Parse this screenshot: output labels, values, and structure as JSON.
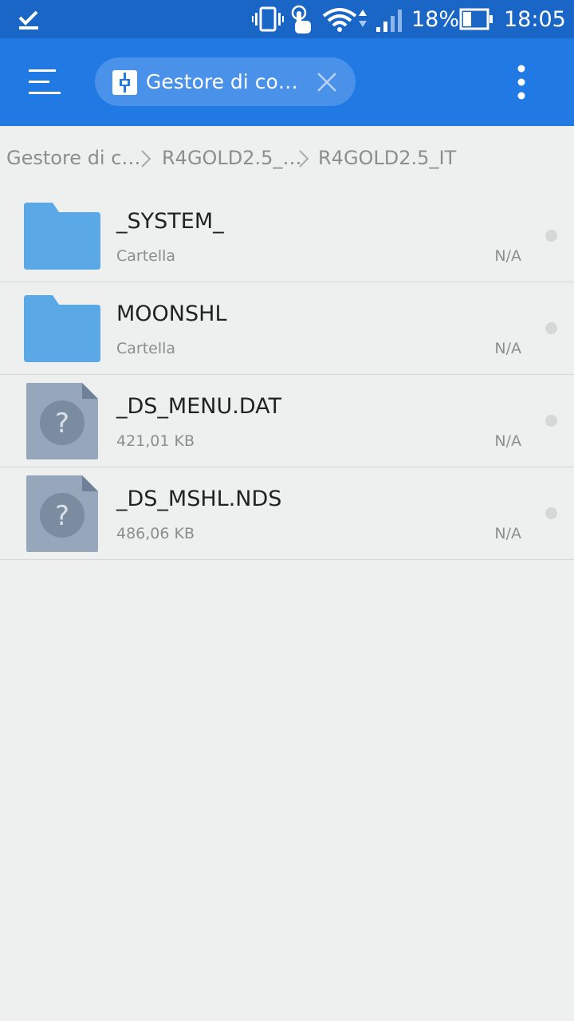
{
  "status_bar": {
    "battery_percent": "18%",
    "time": "18:05",
    "icons": [
      "check-icon",
      "vibrate-icon",
      "touch-icon",
      "wifi-icon",
      "signal-icon",
      "battery-icon"
    ]
  },
  "toolbar": {
    "menu_icon": "menu-icon",
    "tab_label": "Gestore di co…",
    "tab_icon": "app-icon",
    "close_icon": "close-icon",
    "more_icon": "more-vert-icon"
  },
  "breadcrumb": {
    "items": [
      "Gestore di c…",
      "R4GOLD2.5_…",
      "R4GOLD2.5_IT"
    ]
  },
  "files": [
    {
      "name": "_SYSTEM_",
      "meta": "Cartella",
      "date": "N/A",
      "type": "folder"
    },
    {
      "name": "MOONSHL",
      "meta": "Cartella",
      "date": "N/A",
      "type": "folder"
    },
    {
      "name": "_DS_MENU.DAT",
      "meta": "421,01 KB",
      "date": "N/A",
      "type": "unknown-file"
    },
    {
      "name": "_DS_MSHL.NDS",
      "meta": "486,06 KB",
      "date": "N/A",
      "type": "unknown-file"
    }
  ],
  "colors": {
    "status_bar": "#1a66c7",
    "toolbar": "#2179e4",
    "tab_chip": "#4a91ea",
    "background": "#edf0ef",
    "folder": "#5aa9e6",
    "unknown_file": "#97a7bb"
  }
}
